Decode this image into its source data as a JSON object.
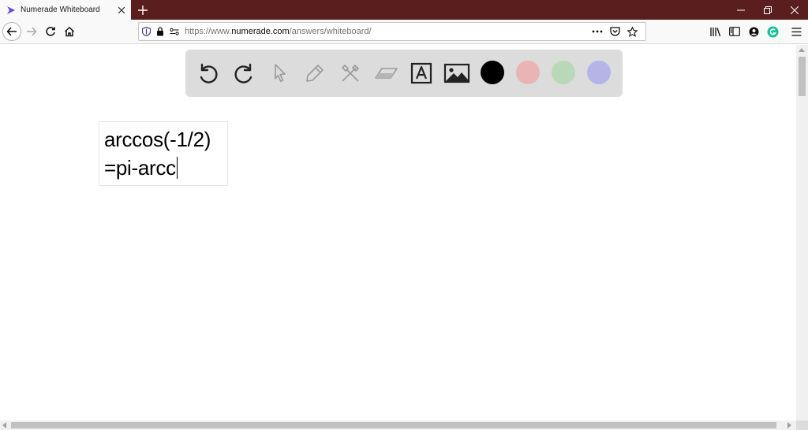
{
  "window": {
    "tab_title": "Numerade Whiteboard",
    "controls": [
      "minimize-icon",
      "restore-icon",
      "close-icon"
    ]
  },
  "navigation": {
    "url_prefix": "https://www.",
    "url_host": "numerade.com",
    "url_path": "/answers/whiteboard/"
  },
  "whiteboard": {
    "tools": [
      "undo-icon",
      "redo-icon",
      "select-pointer-icon",
      "pen-icon",
      "tools-icon",
      "eraser-icon",
      "text-tool-icon",
      "image-tool-icon"
    ],
    "colors": {
      "black": "#000000",
      "pink": "#e8b4b4",
      "green": "#b8d8b8",
      "lavender": "#b4b4e8"
    },
    "text_lines": [
      "arccos(-1/2)",
      "=pi-arcc"
    ]
  },
  "theme": {
    "tabbar_bg": "#5a1e1e",
    "toolbar_bg": "#dcdcdc"
  }
}
